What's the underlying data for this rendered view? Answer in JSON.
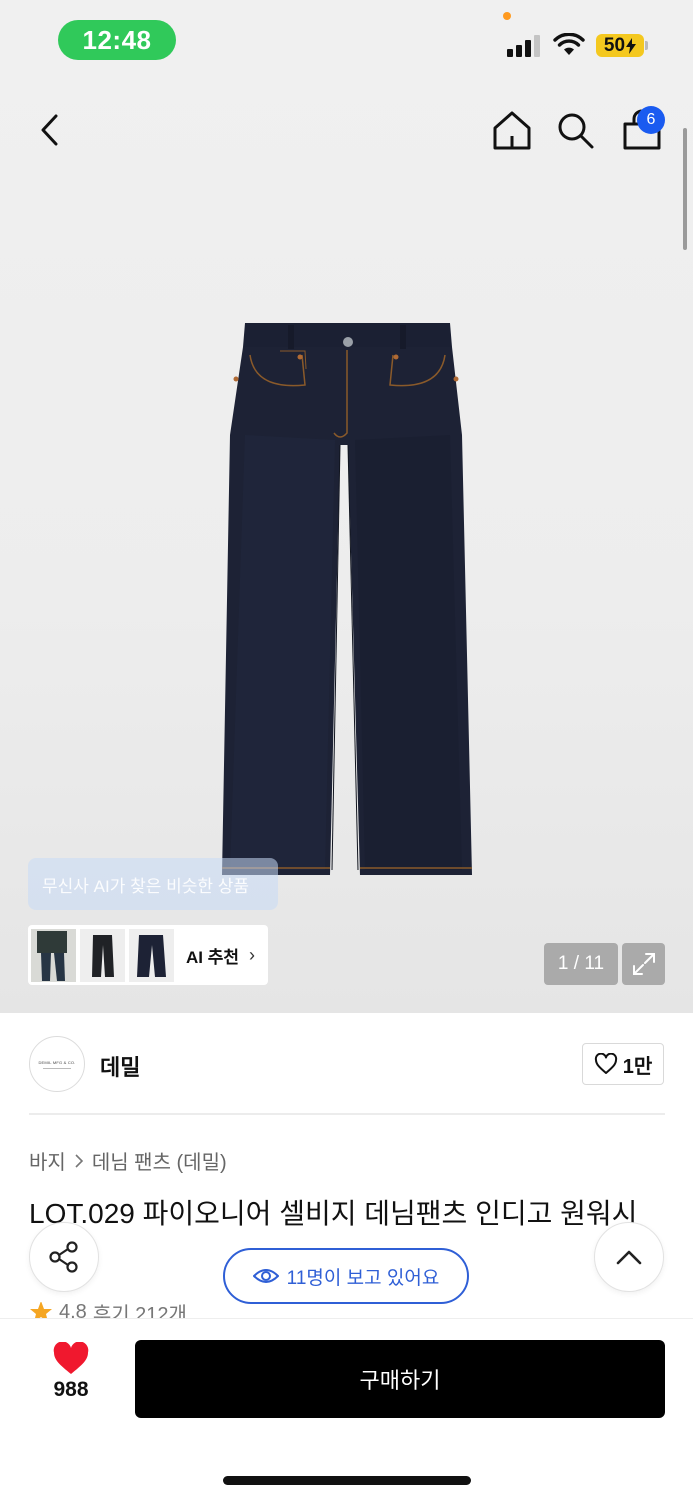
{
  "status_bar": {
    "time": "12:48",
    "battery": "50"
  },
  "nav": {
    "cart_count": "6"
  },
  "gallery": {
    "ai_tooltip": "무신사 AI가 찾은 비슷한 상품",
    "ai_recommend_label": "AI 추천",
    "page_indicator": "1 / 11"
  },
  "brand": {
    "logo_text": "DEMIL MFG & CO.",
    "name": "데밀",
    "likes": "1만"
  },
  "breadcrumb": {
    "category": "바지",
    "subcategory": "데님 팬츠 (데밀)"
  },
  "product": {
    "title": "LOT.029 파이오니어 셀비지 데님팬츠 인디고 원워시",
    "rating": "4.8",
    "reviews": "후기 212개",
    "viewers": "11명이 보고 있어요"
  },
  "bottom": {
    "wish_count": "988",
    "buy_label": "구매하기"
  },
  "colors": {
    "status_green": "#30c95a",
    "badge_blue": "#1a5bf0",
    "viewers_blue": "#2f5fd6",
    "heart_red": "#f0182e",
    "denim": "#1d2235"
  }
}
